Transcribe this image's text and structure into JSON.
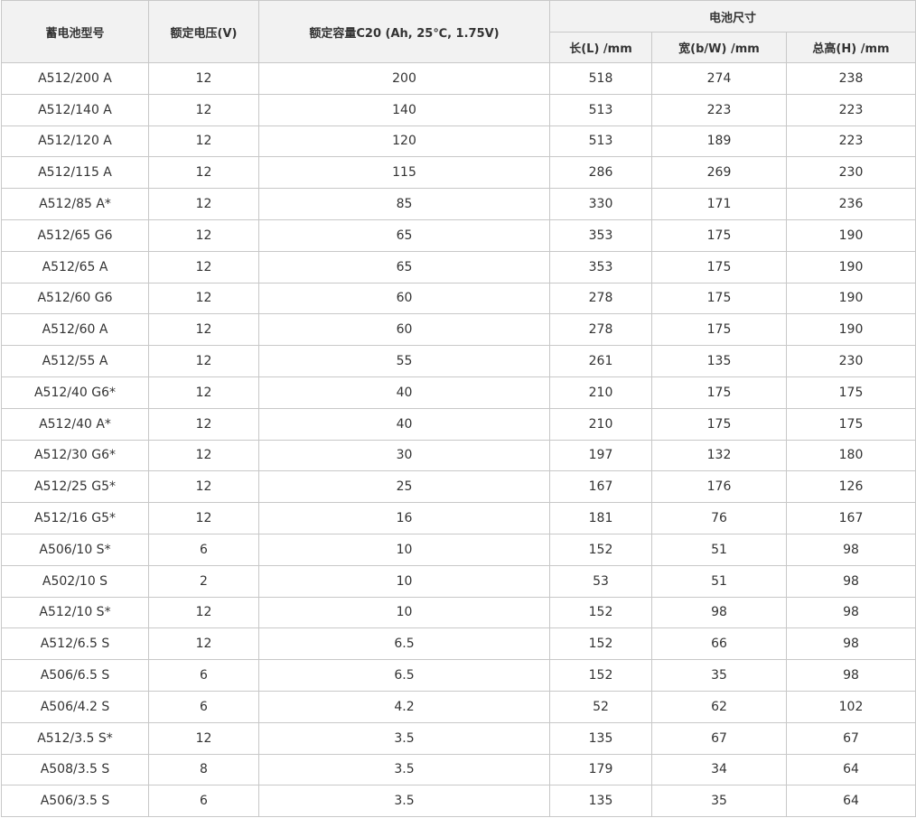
{
  "headers": {
    "model": "蓄电池型号",
    "voltage": "额定电压(V)",
    "capacity": "额定容量C20 (Ah, 25℃, 1.75V)",
    "dimensions": "电池尺寸",
    "length": "长(L) /mm",
    "width": "宽(b/W) /mm",
    "height": "总高(H) /mm"
  },
  "rows": [
    {
      "model": "A512/200 A",
      "voltage": "12",
      "capacity": "200",
      "length": "518",
      "width": "274",
      "height": "238"
    },
    {
      "model": "A512/140 A",
      "voltage": "12",
      "capacity": "140",
      "length": "513",
      "width": "223",
      "height": "223"
    },
    {
      "model": "A512/120 A",
      "voltage": "12",
      "capacity": "120",
      "length": "513",
      "width": "189",
      "height": "223"
    },
    {
      "model": "A512/115 A",
      "voltage": "12",
      "capacity": "115",
      "length": "286",
      "width": "269",
      "height": "230"
    },
    {
      "model": "A512/85 A*",
      "voltage": "12",
      "capacity": "85",
      "length": "330",
      "width": "171",
      "height": "236"
    },
    {
      "model": "A512/65 G6",
      "voltage": "12",
      "capacity": "65",
      "length": "353",
      "width": "175",
      "height": "190"
    },
    {
      "model": "A512/65 A",
      "voltage": "12",
      "capacity": "65",
      "length": "353",
      "width": "175",
      "height": "190"
    },
    {
      "model": "A512/60 G6",
      "voltage": "12",
      "capacity": "60",
      "length": "278",
      "width": "175",
      "height": "190"
    },
    {
      "model": "A512/60 A",
      "voltage": "12",
      "capacity": "60",
      "length": "278",
      "width": "175",
      "height": "190"
    },
    {
      "model": "A512/55 A",
      "voltage": "12",
      "capacity": "55",
      "length": "261",
      "width": "135",
      "height": "230"
    },
    {
      "model": "A512/40 G6*",
      "voltage": "12",
      "capacity": "40",
      "length": "210",
      "width": "175",
      "height": "175"
    },
    {
      "model": "A512/40 A*",
      "voltage": "12",
      "capacity": "40",
      "length": "210",
      "width": "175",
      "height": "175"
    },
    {
      "model": "A512/30 G6*",
      "voltage": "12",
      "capacity": "30",
      "length": "197",
      "width": "132",
      "height": "180"
    },
    {
      "model": "A512/25 G5*",
      "voltage": "12",
      "capacity": "25",
      "length": "167",
      "width": "176",
      "height": "126"
    },
    {
      "model": "A512/16 G5*",
      "voltage": "12",
      "capacity": "16",
      "length": "181",
      "width": "76",
      "height": "167"
    },
    {
      "model": "A506/10 S*",
      "voltage": "6",
      "capacity": "10",
      "length": "152",
      "width": "51",
      "height": "98"
    },
    {
      "model": "A502/10 S",
      "voltage": "2",
      "capacity": "10",
      "length": "53",
      "width": "51",
      "height": "98"
    },
    {
      "model": "A512/10 S*",
      "voltage": "12",
      "capacity": "10",
      "length": "152",
      "width": "98",
      "height": "98"
    },
    {
      "model": "A512/6.5 S",
      "voltage": "12",
      "capacity": "6.5",
      "length": "152",
      "width": "66",
      "height": "98"
    },
    {
      "model": "A506/6.5 S",
      "voltage": "6",
      "capacity": "6.5",
      "length": "152",
      "width": "35",
      "height": "98"
    },
    {
      "model": "A506/4.2 S",
      "voltage": "6",
      "capacity": "4.2",
      "length": "52",
      "width": "62",
      "height": "102"
    },
    {
      "model": "A512/3.5 S*",
      "voltage": "12",
      "capacity": "3.5",
      "length": "135",
      "width": "67",
      "height": "67"
    },
    {
      "model": "A508/3.5 S",
      "voltage": "8",
      "capacity": "3.5",
      "length": "179",
      "width": "34",
      "height": "64"
    },
    {
      "model": "A506/3.5 S",
      "voltage": "6",
      "capacity": "3.5",
      "length": "135",
      "width": "35",
      "height": "64"
    }
  ]
}
